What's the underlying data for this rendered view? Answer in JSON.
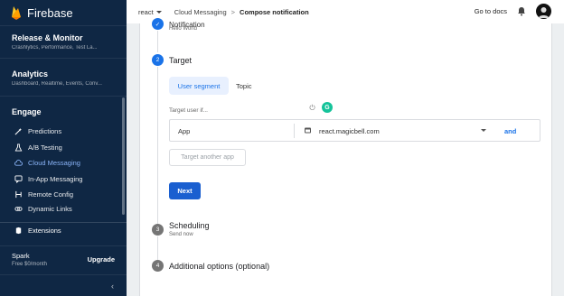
{
  "sidebar": {
    "brand": "Firebase",
    "sections": [
      {
        "title": "Release & Monitor",
        "subtitle": "Crashlytics, Performance, Test La..."
      },
      {
        "title": "Analytics",
        "subtitle": "Dashboard, Realtime, Events, Conv..."
      }
    ],
    "engage_title": "Engage",
    "items": [
      {
        "label": "Predictions",
        "icon": "wand-icon"
      },
      {
        "label": "A/B Testing",
        "icon": "flask-icon"
      },
      {
        "label": "Cloud Messaging",
        "icon": "cloud-icon",
        "active": true
      },
      {
        "label": "In-App Messaging",
        "icon": "chat-icon"
      },
      {
        "label": "Remote Config",
        "icon": "config-icon"
      },
      {
        "label": "Dynamic Links",
        "icon": "link-icon"
      }
    ],
    "extensions_label": "Extensions",
    "plan_name": "Spark",
    "plan_sub": "Free $0/month",
    "upgrade_label": "Upgrade",
    "collapse_icon": "chevron-left-icon"
  },
  "header": {
    "project": "react",
    "breadcrumb_parent": "Cloud Messaging",
    "breadcrumb_separator": ">",
    "breadcrumb_current": "Compose notification",
    "docs_link": "Go to docs"
  },
  "steps": {
    "notification": {
      "title": "Notification",
      "subtitle": "Hello World"
    },
    "target": {
      "number": "2",
      "title": "Target"
    },
    "scheduling": {
      "number": "3",
      "title": "Scheduling",
      "subtitle": "Send now"
    },
    "additional": {
      "number": "4",
      "title": "Additional options (optional)"
    }
  },
  "target": {
    "tabs": {
      "user_segment": "User segment",
      "topic": "Topic"
    },
    "label": "Target user if...",
    "rule": {
      "field": "App",
      "value": "react.magicbell.com",
      "and_label": "and"
    },
    "another_app_button": "Target another app",
    "next_button": "Next"
  },
  "colors": {
    "sidebar_bg": "#0f2744",
    "accent": "#1a73e8",
    "active_nav": "#8ab4f8",
    "next_button": "#1a5fd0",
    "grammarly": "#15c39a"
  }
}
